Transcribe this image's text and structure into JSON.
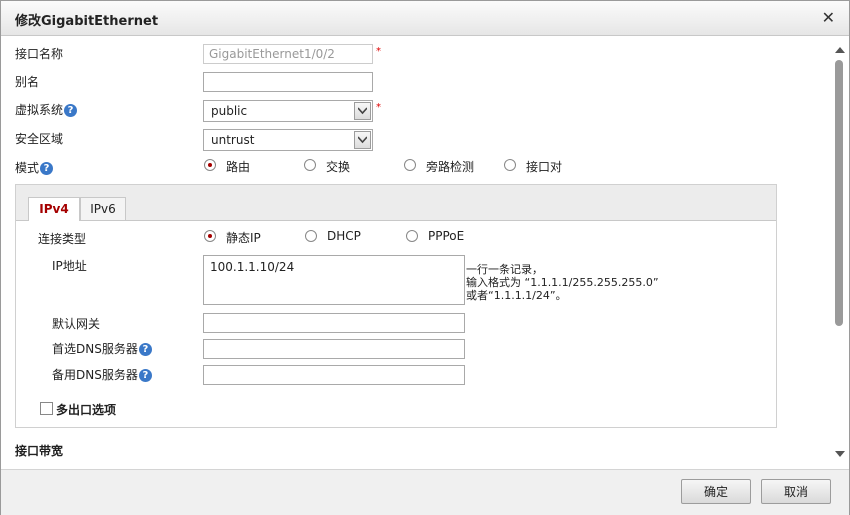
{
  "dialog": {
    "title": "修改GigabitEthernet",
    "close_icon": "close-icon"
  },
  "form": {
    "interface_name_label": "接口名称",
    "interface_name_value": "GigabitEthernet1/0/2",
    "required_mark": "*",
    "alias_label": "别名",
    "alias_value": "",
    "vsys_label": "虚拟系统",
    "vsys_value": "public",
    "zone_label": "安全区域",
    "zone_value": "untrust",
    "mode_label": "模式",
    "help_glyph": "?",
    "mode_options": [
      "路由",
      "交换",
      "旁路检测",
      "接口对"
    ],
    "mode_selected": "路由"
  },
  "tabs": {
    "ipv4": "IPv4",
    "ipv6": "IPv6",
    "active": "IPv4"
  },
  "ipv4": {
    "conn_type_label": "连接类型",
    "conn_options": [
      "静态IP",
      "DHCP",
      "PPPoE"
    ],
    "conn_selected": "静态IP",
    "ip_label": "IP地址",
    "ip_value": "100.1.1.10/24",
    "hint_line1": "一行一条记录，",
    "hint_line2": "输入格式为 “1.1.1.1/255.255.255.0”",
    "hint_line3": "或者“1.1.1.1/24”。",
    "gateway_label": "默认网关",
    "gateway_value": "",
    "dns1_label": "首选DNS服务器",
    "dns1_value": "",
    "dns2_label": "备用DNS服务器",
    "dns2_value": "",
    "multi_egress_label": "多出口选项",
    "multi_egress_checked": false
  },
  "bandwidth_section": "接口带宽",
  "footer": {
    "ok": "确定",
    "cancel": "取消"
  },
  "colors": {
    "accent": "#a50000",
    "help": "#3a78c8",
    "required": "#dd0000"
  }
}
